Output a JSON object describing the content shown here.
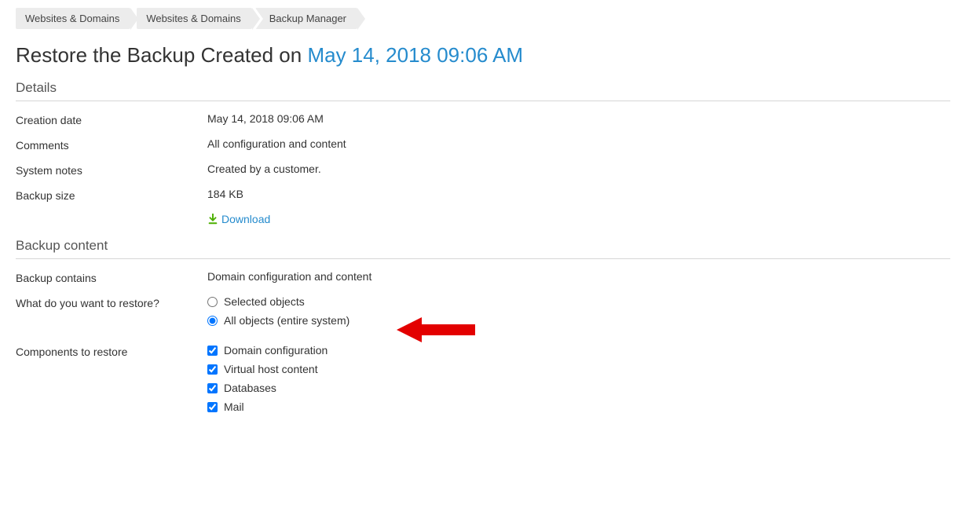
{
  "breadcrumb_top": {
    "item1": "Websites & Domains"
  },
  "breadcrumb_main": {
    "item1": "Websites & Domains",
    "item2": "Backup Manager"
  },
  "page_title": {
    "prefix": "Restore the Backup Created on ",
    "date": "May 14, 2018 09:06 AM"
  },
  "details": {
    "section_label": "Details",
    "creation_date_label": "Creation date",
    "creation_date_value": "May 14, 2018 09:06 AM",
    "comments_label": "Comments",
    "comments_value": "All configuration and content",
    "system_notes_label": "System notes",
    "system_notes_value": "Created by a customer.",
    "backup_size_label": "Backup size",
    "backup_size_value": "184 KB",
    "download_label": "Download"
  },
  "backup_content": {
    "section_label": "Backup content",
    "contains_label": "Backup contains",
    "contains_value": "Domain configuration and content",
    "restore_q_label": "What do you want to restore?",
    "restore_options": {
      "selected_objects": "Selected objects",
      "all_objects": "All objects (entire system)"
    },
    "components_label": "Components to restore",
    "components": {
      "domain_config": "Domain configuration",
      "vhost": "Virtual host content",
      "databases": "Databases",
      "mail": "Mail"
    }
  }
}
